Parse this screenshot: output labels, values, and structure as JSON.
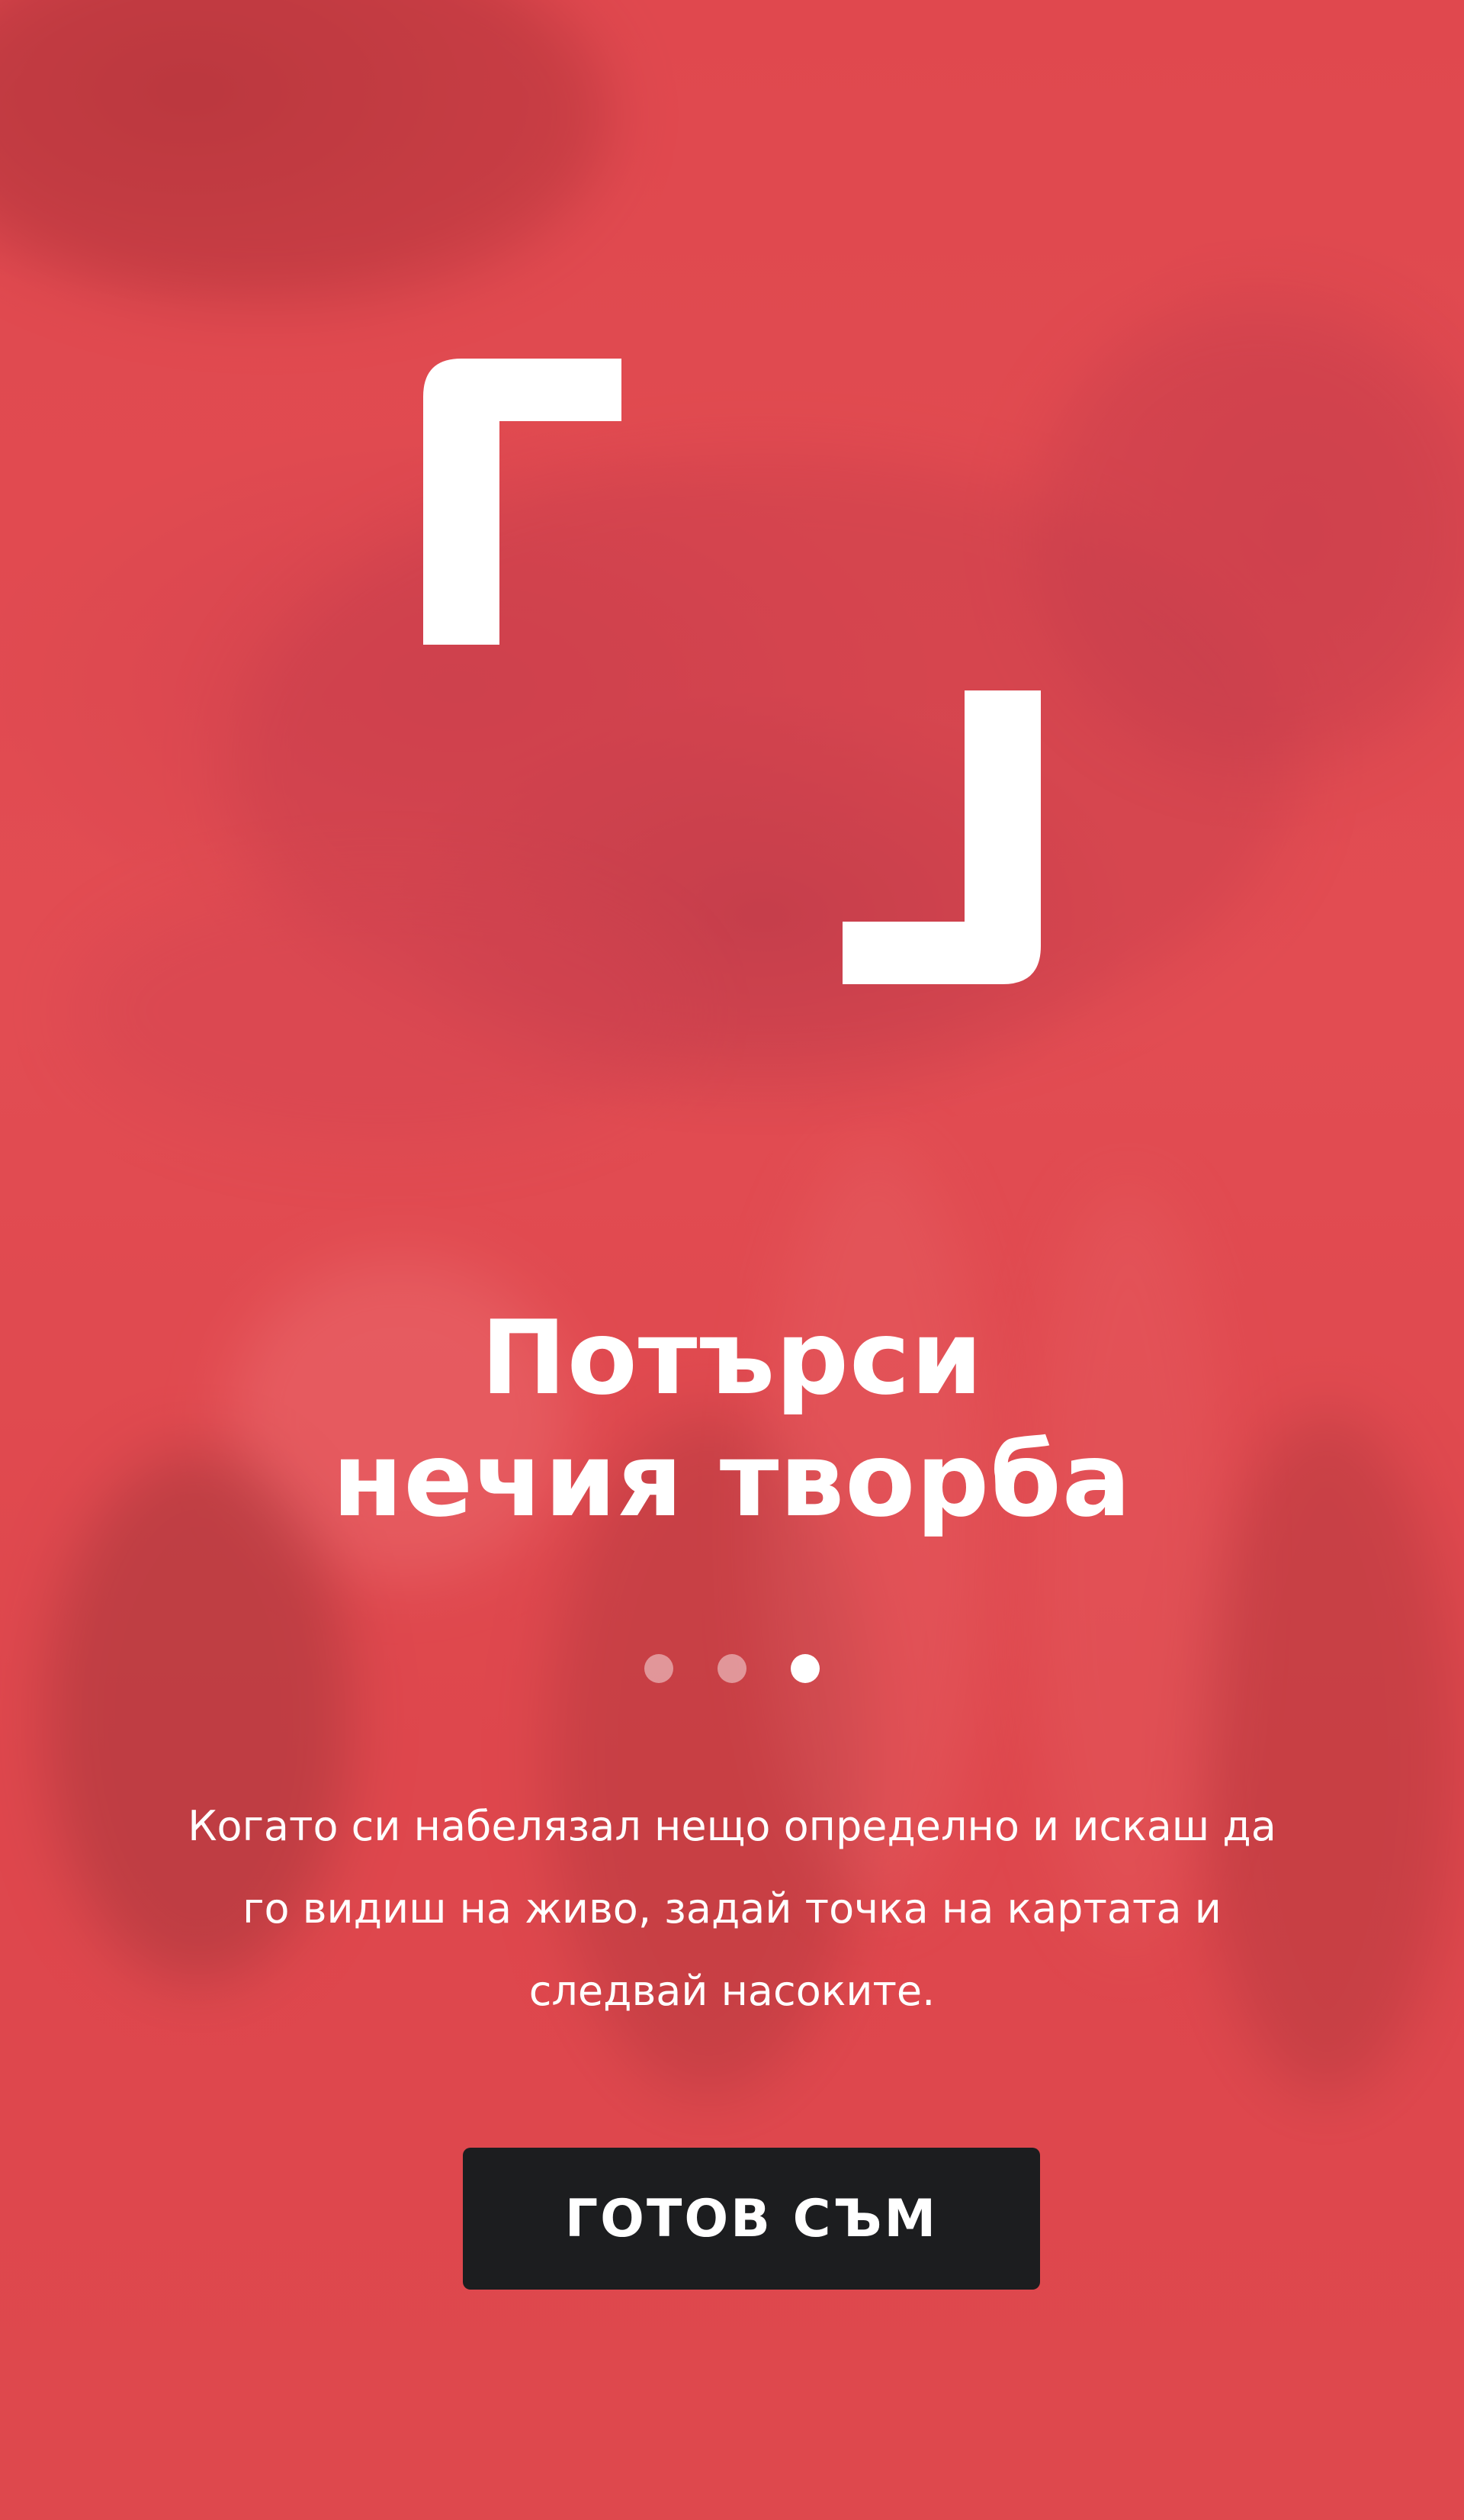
{
  "onboarding": {
    "title_line_1": "Потърси",
    "title_line_2": "нечия творба",
    "description_line_1": "Когато си набелязал нещо определно и искаш да",
    "description_line_2": "го видиш на живо, задай точка на картата и",
    "description_line_3": "следвай насоките.",
    "cta_label": "ГОТОВ СЪМ",
    "pagination": {
      "total": 3,
      "active": 3
    }
  },
  "colors": {
    "background": "#d9434a",
    "text": "#ffffff",
    "button": "#1c1d1f",
    "dot_inactive": "rgba(255,255,255,0.45)",
    "dot_active": "#ffffff"
  },
  "icons": {
    "logo": "corner-brackets-logo-icon"
  }
}
